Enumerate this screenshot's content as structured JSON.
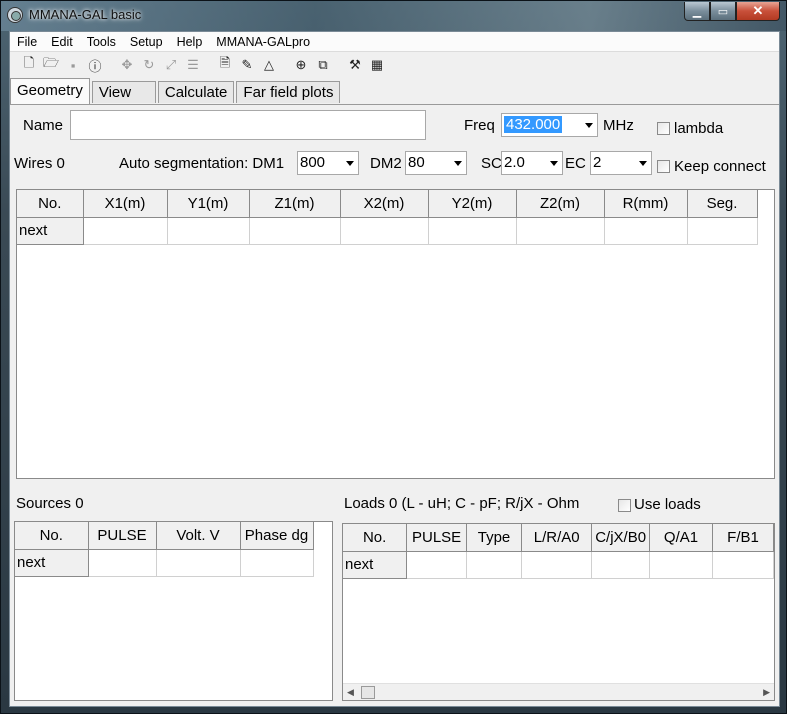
{
  "window": {
    "title": "MMANA-GAL basic"
  },
  "menu": [
    "File",
    "Edit",
    "Tools",
    "Setup",
    "Help",
    "MMANA-GALpro"
  ],
  "toolbar": {
    "icons": [
      "new-file-icon",
      "open-folder-icon",
      "save-icon",
      "info-icon",
      "move-icon",
      "rotate-icon",
      "scale-icon",
      "adjust-icon",
      "page-icon",
      "pen-icon",
      "triangle-icon",
      "target-icon",
      "copy-icon",
      "tools-icon",
      "calculator-icon"
    ]
  },
  "tabs": [
    "Geometry",
    "View",
    "Calculate",
    "Far field plots"
  ],
  "geometry": {
    "name_label": "Name",
    "name_value": "",
    "freq_label": "Freq",
    "freq_value": "432.000",
    "freq_unit": "MHz",
    "lambda_label": "lambda",
    "wires_label": "Wires 0",
    "auto_seg_label": "Auto segmentation: DM1",
    "dm1_value": "800",
    "dm2_label": "DM2",
    "dm2_value": "80",
    "sc_label": "SC",
    "sc_value": "2.0",
    "ec_label": "EC",
    "ec_value": "2",
    "keep_connect_label": "Keep connect"
  },
  "wires_table": {
    "columns": [
      "No.",
      "X1(m)",
      "Y1(m)",
      "Z1(m)",
      "X2(m)",
      "Y2(m)",
      "Z2(m)",
      "R(mm)",
      "Seg."
    ],
    "rows": [
      [
        "next",
        "",
        "",
        "",
        "",
        "",
        "",
        "",
        ""
      ]
    ]
  },
  "sources": {
    "label": "Sources 0",
    "columns": [
      "No.",
      "PULSE",
      "Volt. V",
      "Phase dg"
    ],
    "rows": [
      [
        "next",
        "",
        "",
        ""
      ]
    ]
  },
  "loads": {
    "label": "Loads 0 (L - uH; C - pF; R/jX - Ohm",
    "use_loads_label": "Use loads",
    "columns": [
      "No.",
      "PULSE",
      "Type",
      "L/R/A0",
      "C/jX/B0",
      "Q/A1",
      "F/B1"
    ],
    "rows": [
      [
        "next",
        "",
        "",
        "",
        "",
        "",
        ""
      ]
    ]
  }
}
